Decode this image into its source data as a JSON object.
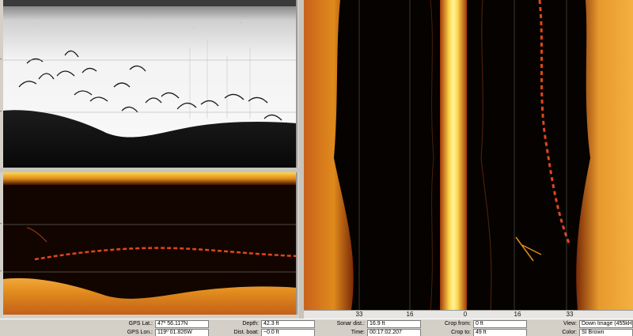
{
  "side_scan": {
    "tick_labels": [
      "33",
      "16",
      "0",
      "16",
      "33"
    ]
  },
  "status": {
    "rows": [
      [
        {
          "label": "GPS Lat.:",
          "value": "47º 56.117N"
        },
        {
          "label": "Depth:",
          "value": "42.3 ft"
        },
        {
          "label": "Sonar dist.:",
          "value": "16.9 ft"
        },
        {
          "label": "Crop from:",
          "value": "0 ft"
        },
        {
          "label": "View:",
          "value": "Down Image (455kHz)"
        }
      ],
      [
        {
          "label": "GPS Lon.:",
          "value": "119º 01.826W"
        },
        {
          "label": "Dist. boat:",
          "value": "~0.0 ft"
        },
        {
          "label": "Time:",
          "value": "00:17:02.207"
        },
        {
          "label": "Crop to:",
          "value": "49 ft"
        },
        {
          "label": "Color:",
          "value": "SI Brown"
        }
      ]
    ]
  },
  "colors": {
    "sonar_orange": "#e08a1c",
    "sonar_yellow": "#ffd84a",
    "background_dark": "#050200",
    "panel_gray": "#d4d0c8"
  }
}
